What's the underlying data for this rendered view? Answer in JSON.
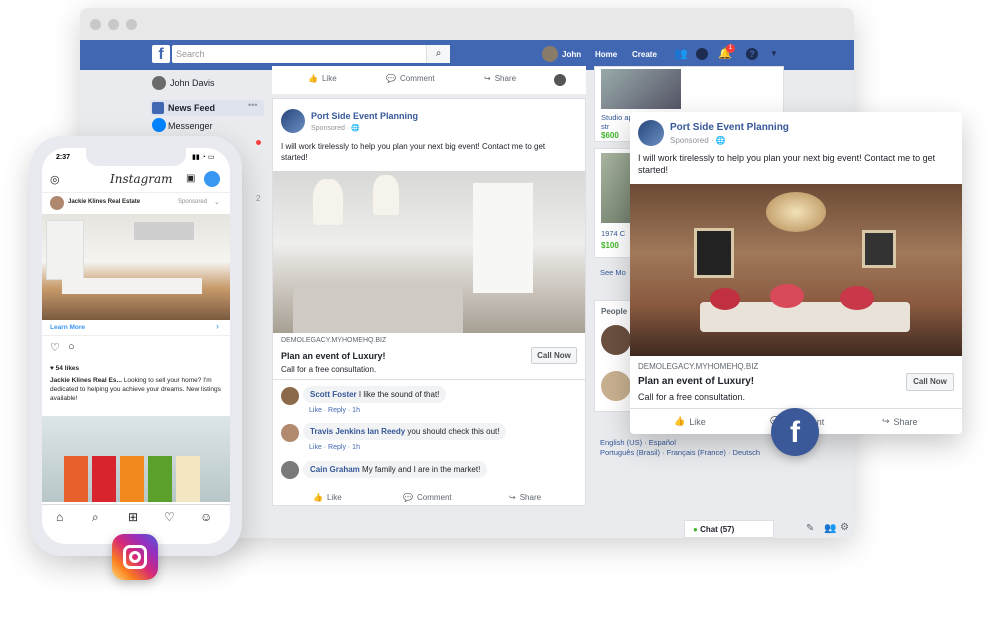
{
  "facebook": {
    "search_placeholder": "Search",
    "nav": {
      "user": "John",
      "home": "Home",
      "create": "Create",
      "notif_count": "1"
    },
    "sidebar": {
      "user": "John Davis",
      "news_feed": "News Feed",
      "messenger": "Messenger",
      "count": "2"
    },
    "feed_actions": {
      "like": "Like",
      "comment": "Comment",
      "share": "Share"
    },
    "post": {
      "page_name": "Port Side Event Planning",
      "sponsored": "Sponsored",
      "text": "I will work tirelessly to help you plan your next big event! Contact me to get started!",
      "ad_url": "DEMOLEGACY.MYHOMEHQ.BIZ",
      "ad_headline": "Plan an event of Luxury!",
      "ad_sub": "Call for a free consultation.",
      "cta": "Call Now",
      "comments": [
        {
          "name": "Scott Foster",
          "text": "I like the sound of that!",
          "links": "Like · Reply · 1h"
        },
        {
          "name": "Travis Jenkins",
          "mention": "Ian Reedy",
          "text": "you should check this out!",
          "links": "Like · Reply · 1h"
        },
        {
          "name": "Cain Graham",
          "text": "My family and I are in the market!",
          "links": ""
        }
      ]
    },
    "right": {
      "listing1": "Studio apartments across the str",
      "price1": "$600",
      "listing2": "1974 C",
      "price2": "$100",
      "see_more": "See Mo",
      "people": "People",
      "languages": "English (US) · Español\nPortuguês (Brasil) · Français (France) · Deutsch"
    },
    "chat": "Chat (57)"
  },
  "popup": {
    "page_name": "Port Side Event Planning",
    "sponsored": "Sponsored",
    "text": "I will work tirelessly to help you plan your next big event! Contact me to get started!",
    "ad_url": "DEMOLEGACY.MYHOMEHQ.BIZ",
    "ad_headline": "Plan an event of Luxury!",
    "ad_sub": "Call for a free consultation.",
    "cta": "Call Now",
    "like": "Like",
    "comment": "Comment",
    "share": "Share"
  },
  "instagram": {
    "time": "2:37",
    "logo": "Instagram",
    "account": "Jackie Klines Real Estate",
    "sponsored": "Sponsored",
    "learn_more": "Learn More",
    "likes": "54 likes",
    "caption_name": "Jackie Klines Real Es...",
    "caption": "Looking to sell your home? I'm dedicated to helping you achieve your dreams. New listings available!"
  },
  "colors": {
    "fb_blue": "#4267b2",
    "fb_badge": "#3b5998"
  }
}
